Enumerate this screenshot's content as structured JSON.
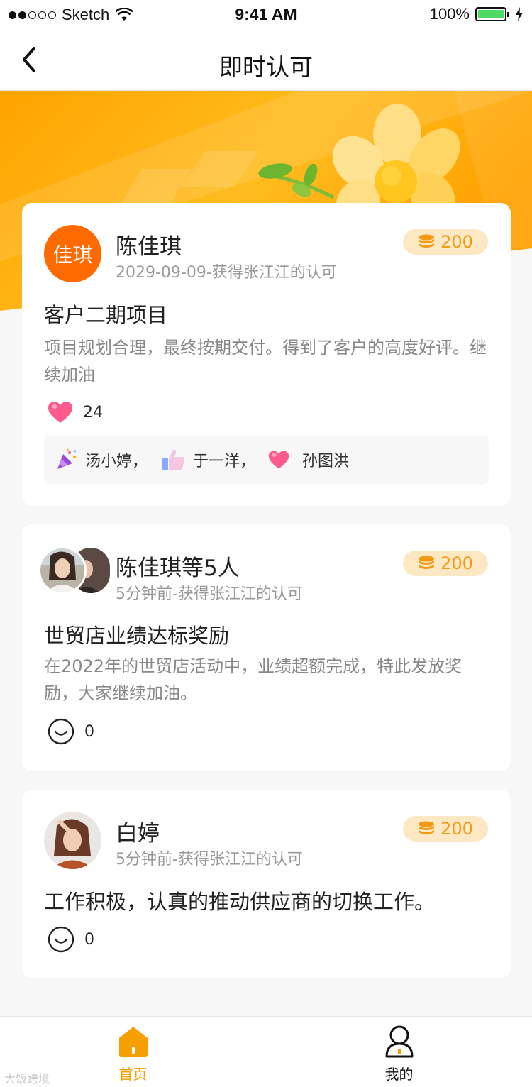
{
  "status_bar": {
    "carrier": "Sketch",
    "time": "9:41 AM",
    "battery": "100%"
  },
  "nav": {
    "title": "即时认可"
  },
  "cards": [
    {
      "avatar_text": "佳琪",
      "name": "陈佳琪",
      "meta": "2029-09-09-获得张江江的认可",
      "coins": "200",
      "title": "客户二期项目",
      "desc": "项目规划合理，最终按期交付。得到了客户的高度好评。继续加油",
      "likes": "24",
      "reactors": [
        {
          "icon": "party-popper-icon",
          "label": "汤小婷，"
        },
        {
          "icon": "thumbs-up-icon",
          "label": "于一洋，"
        },
        {
          "icon": "heart-icon",
          "label": "孙图洪"
        }
      ]
    },
    {
      "name": "陈佳琪等5人",
      "meta": "5分钟前-获得张江江的认可",
      "coins": "200",
      "title": "世贸店业绩达标奖励",
      "desc": "在2022年的世贸店活动中，业绩超额完成，特此发放奖励，大家继续加油。",
      "reactions": "0"
    },
    {
      "name": "白婷",
      "meta": "5分钟前-获得张江江的认可",
      "coins": "200",
      "title": "工作积极，认真的推动供应商的切换工作。",
      "reactions": "0"
    }
  ],
  "tabs": [
    {
      "label": "首页",
      "active": true
    },
    {
      "label": "我的",
      "active": false
    }
  ],
  "watermark": "大饭跨境",
  "colors": {
    "accent": "#f5a000",
    "banner": "#ffb300",
    "avatar_orange": "#ff6a00",
    "coin": "#f29a13"
  }
}
